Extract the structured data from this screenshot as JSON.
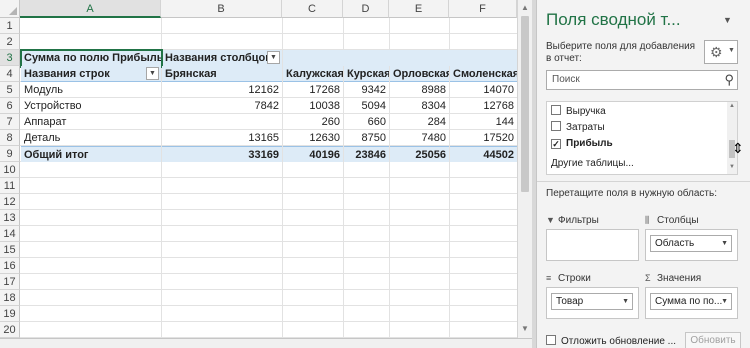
{
  "sheet": {
    "columns": [
      "A",
      "B",
      "C",
      "D",
      "E",
      "F"
    ],
    "row_numbers": [
      "1",
      "2",
      "3",
      "4",
      "5",
      "6",
      "7",
      "8",
      "9",
      "10",
      "11",
      "12",
      "13",
      "14",
      "15",
      "16",
      "17",
      "18",
      "19",
      "20"
    ],
    "pivot": {
      "value_caption": "Сумма по полю Прибыль",
      "col_caption": "Названия столбцов",
      "row_caption": "Названия строк",
      "col_headers": [
        "Брянская",
        "Калужская",
        "Курская",
        "Орловская",
        "Смоленская"
      ],
      "rows": [
        {
          "label": "Модуль",
          "values": [
            "12162",
            "17268",
            "9342",
            "8988",
            "14070"
          ]
        },
        {
          "label": "Устройство",
          "values": [
            "7842",
            "10038",
            "5094",
            "8304",
            "12768"
          ]
        },
        {
          "label": "Аппарат",
          "values": [
            "",
            "260",
            "660",
            "284",
            "144"
          ]
        },
        {
          "label": "Деталь",
          "values": [
            "13165",
            "12630",
            "8750",
            "7480",
            "17520"
          ]
        }
      ],
      "total": {
        "label": "Общий итог",
        "values": [
          "33169",
          "40196",
          "23846",
          "25056",
          "44502"
        ]
      }
    }
  },
  "pane": {
    "title": "Поля сводной т...",
    "hint": "Выберите поля для добавления в отчет:",
    "search_placeholder": "Поиск",
    "fields": [
      {
        "label": "Выручка",
        "checked": ""
      },
      {
        "label": "Затраты",
        "checked": ""
      },
      {
        "label": "Прибыль",
        "checked": "✓"
      }
    ],
    "other_tables": "Другие таблицы...",
    "drag_hint": "Перетащите поля в нужную область:",
    "zones": {
      "filters": {
        "label": "Фильтры",
        "value": ""
      },
      "columns": {
        "label": "Столбцы",
        "value": "Область"
      },
      "rows": {
        "label": "Строки",
        "value": "Товар"
      },
      "values": {
        "label": "Значения",
        "value": "Сумма по по..."
      }
    },
    "defer_label": "Отложить обновление ...",
    "update_button": "Обновить"
  },
  "colors": {
    "accent": "#217346",
    "pivot_fill": "#ddebf7"
  }
}
